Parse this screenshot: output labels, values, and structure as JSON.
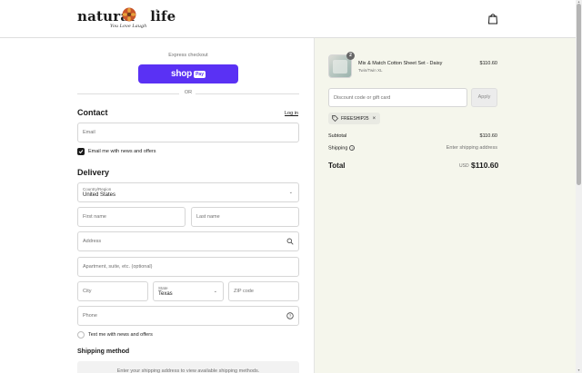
{
  "header": {
    "logo_text_left": "natural",
    "logo_text_right": "life",
    "logo_trademark": "®",
    "logo_tagline": "You Love Laugh",
    "bag_icon": "shopping-bag-icon"
  },
  "express": {
    "label": "Express checkout",
    "shop_pay_word": "shop",
    "shop_pay_badge": "Pay",
    "or_text": "OR"
  },
  "contact": {
    "title": "Contact",
    "login_link": "Log in",
    "email_placeholder": "Email",
    "email_offers_label": "Email me with news and offers",
    "email_offers_checked": true
  },
  "delivery": {
    "title": "Delivery",
    "country_label": "Country/Region",
    "country_value": "United States",
    "first_name_placeholder": "First name",
    "last_name_placeholder": "Last name",
    "address_placeholder": "Address",
    "apartment_placeholder": "Apartment, suite, etc. (optional)",
    "city_placeholder": "City",
    "state_label": "State",
    "state_value": "Texas",
    "zip_placeholder": "ZIP code",
    "phone_placeholder": "Phone",
    "text_offers_label": "Text me with news and offers",
    "text_offers_checked": false
  },
  "shipping": {
    "title": "Shipping method",
    "placeholder_text": "Enter your shipping address to view available shipping methods."
  },
  "order": {
    "item": {
      "quantity": "2",
      "name": "Mix & Match Cotton Sheet Set - Daisy",
      "variant": "Twin/Twin XL",
      "price": "$110.60"
    },
    "discount_placeholder": "Discount code or gift card",
    "apply_label": "Apply",
    "applied_code": "FREESHIP25",
    "subtotal_label": "Subtotal",
    "subtotal_value": "$110.60",
    "shipping_label": "Shipping",
    "shipping_value": "Enter shipping address",
    "total_label": "Total",
    "total_currency": "USD",
    "total_value": "$110.60"
  },
  "colors": {
    "shop_pay_purple": "#5a31f4",
    "summary_background": "#f5f6ec",
    "checkbox_dark": "#1a1a1a"
  }
}
